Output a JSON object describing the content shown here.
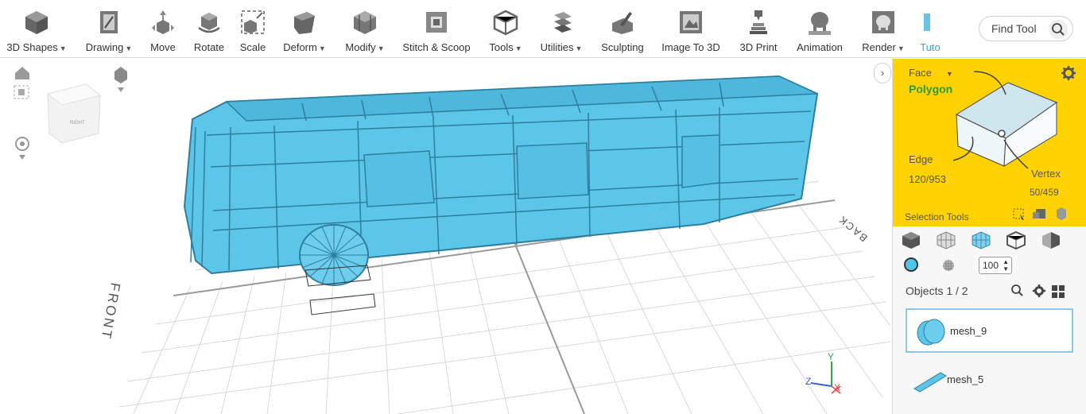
{
  "toolbar": {
    "tools": [
      {
        "label": "3D Shapes",
        "dropdown": true,
        "icon": "cube-icon"
      },
      {
        "label": "Drawing",
        "dropdown": true,
        "icon": "drawing-icon"
      },
      {
        "label": "Move",
        "dropdown": false,
        "icon": "move-icon"
      },
      {
        "label": "Rotate",
        "dropdown": false,
        "icon": "rotate-icon"
      },
      {
        "label": "Scale",
        "dropdown": false,
        "icon": "scale-icon"
      },
      {
        "label": "Deform",
        "dropdown": true,
        "icon": "deform-icon"
      },
      {
        "label": "Modify",
        "dropdown": true,
        "icon": "modify-icon"
      },
      {
        "label": "Stitch & Scoop",
        "dropdown": false,
        "icon": "stitch-scoop-icon"
      },
      {
        "label": "Tools",
        "dropdown": true,
        "icon": "tools-icon"
      },
      {
        "label": "Utilities",
        "dropdown": true,
        "icon": "utilities-icon"
      },
      {
        "label": "Sculpting",
        "dropdown": false,
        "icon": "sculpting-icon"
      },
      {
        "label": "Image To 3D",
        "dropdown": false,
        "icon": "image-to-3d-icon"
      },
      {
        "label": "3D Print",
        "dropdown": false,
        "icon": "3d-print-icon"
      },
      {
        "label": "Animation",
        "dropdown": false,
        "icon": "animation-icon"
      },
      {
        "label": "Render",
        "dropdown": true,
        "icon": "render-icon"
      },
      {
        "label": "Tuto",
        "dropdown": false,
        "icon": "tutorial-icon"
      }
    ],
    "find_tool": {
      "placeholder": "Find Tool"
    }
  },
  "viewport": {
    "nav_cube_label": "RIGHT",
    "front_label": "FRONT",
    "back_label": "BACK",
    "axis": {
      "x": "X",
      "y": "Y",
      "z": "Z"
    }
  },
  "selection": {
    "mode_label": "Face",
    "mode_value": "Polygon",
    "edge_label": "Edge",
    "edge_count": "120/953",
    "vertex_label": "Vertex",
    "vertex_count": "50/459",
    "tools_label": "Selection Tools",
    "accent": "#ffd200",
    "polygon_color": "#2a9a3f"
  },
  "options": {
    "opacity_value": "100",
    "material_color": "#4fc5e9"
  },
  "objects": {
    "header": "Objects 1 / 2",
    "items": [
      {
        "name": "mesh_9",
        "selected": true
      },
      {
        "name": "mesh_5",
        "selected": false
      }
    ]
  }
}
